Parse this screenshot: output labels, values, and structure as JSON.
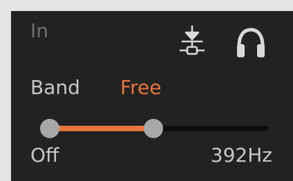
{
  "header": {
    "in_label": "In",
    "tune_icon": "tuning-fork-icon",
    "monitor_icon": "headphones-icon"
  },
  "band": {
    "label": "Band",
    "value": "Free"
  },
  "range": {
    "low_fraction": 0.0,
    "high_fraction": 0.475,
    "min_label": "Off",
    "max_label": "392Hz"
  },
  "colors": {
    "panel": "#222222",
    "frame": "#e3e3e3",
    "accent": "#e8753b",
    "thumb": "#a8a8a8",
    "track": "#0e0e0e"
  }
}
